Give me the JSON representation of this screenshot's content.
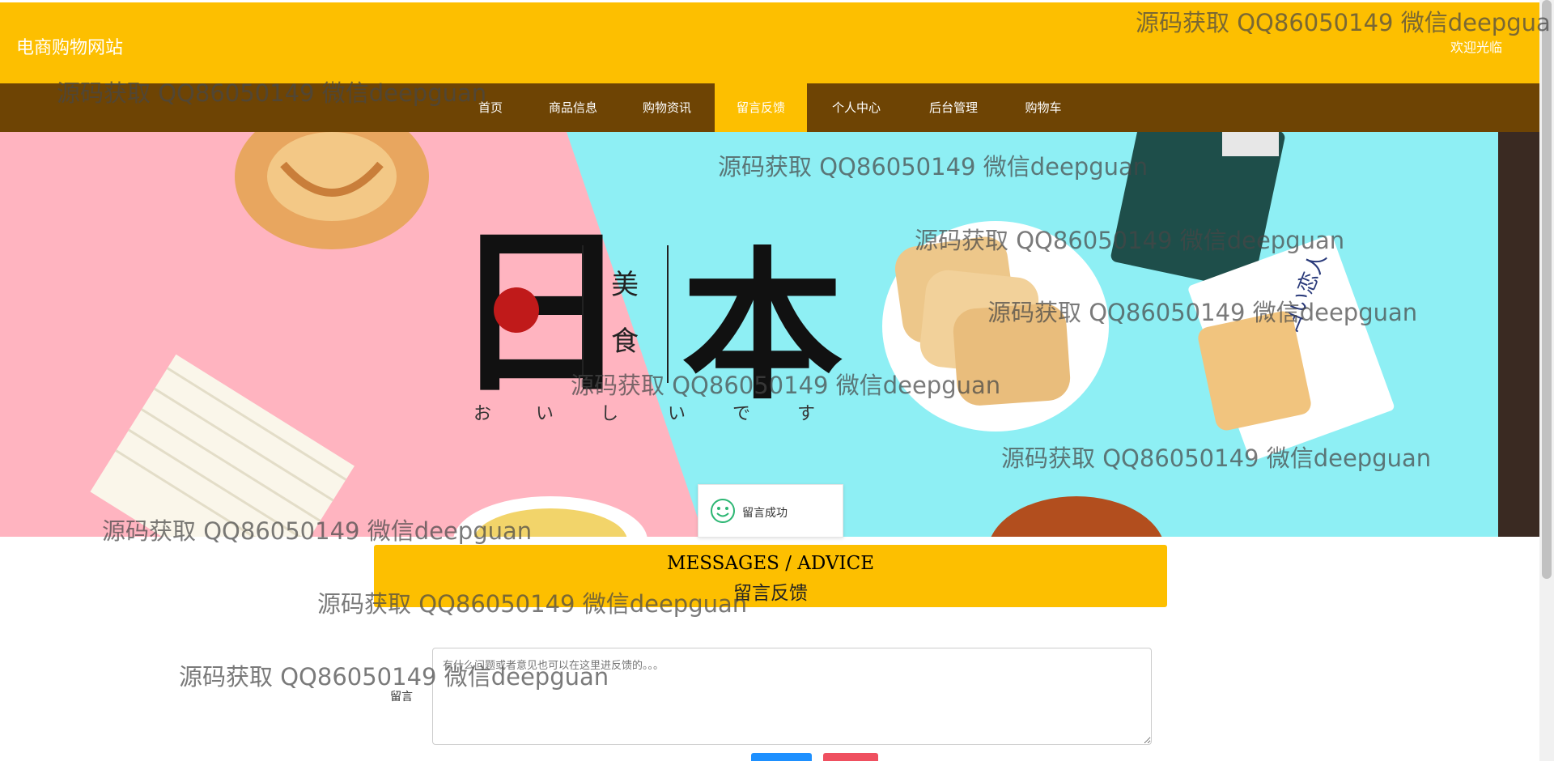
{
  "header": {
    "site_title": "电商购物网站",
    "welcome": "欢迎光临"
  },
  "nav": {
    "items": [
      "首页",
      "商品信息",
      "购物资讯",
      "留言反馈",
      "个人中心",
      "后台管理",
      "购物车"
    ],
    "active_index": 3
  },
  "banner": {
    "big_text_left": "日",
    "big_text_right": "本",
    "small_text_top": "美",
    "small_text_bottom": "食",
    "kana": [
      "お",
      "い",
      "し",
      "い",
      "で",
      "す"
    ],
    "package_text": "白い恋人"
  },
  "toast": {
    "icon": "smile-icon",
    "text": "留言成功"
  },
  "section": {
    "title_en": "MESSAGES / ADVICE",
    "title_zh": "留言反馈"
  },
  "form": {
    "label": "留言",
    "placeholder": "有什么问题或者意见也可以在这里进反馈的。。。"
  },
  "watermark": {
    "text": "源码获取 QQ86050149 微信deepguan",
    "text_truncated": "源码获取 QQ86050149 微信deepgua"
  },
  "colors": {
    "header_bg": "#FDBF00",
    "nav_bg": "#6E4404",
    "active_tab": "#FDBF00",
    "submit_button": "#1E90FF",
    "reset_button": "#EF5060"
  }
}
